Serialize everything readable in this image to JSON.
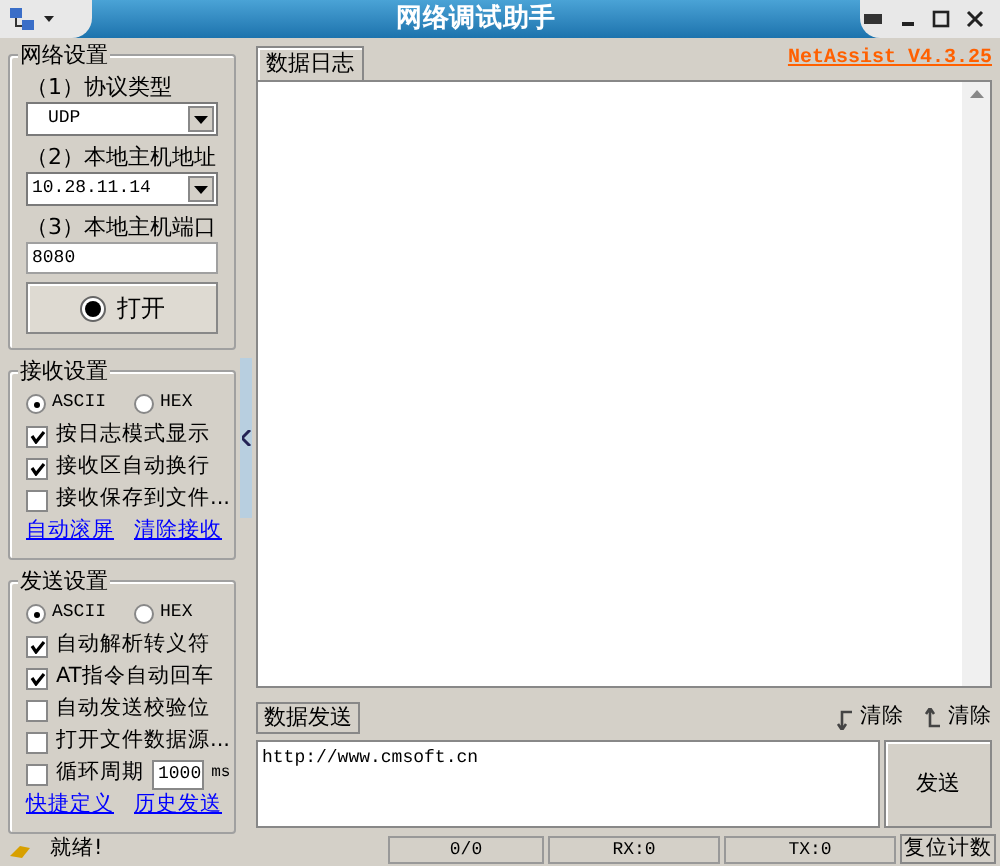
{
  "window": {
    "title": "网络调试助手"
  },
  "network_settings": {
    "title": "网络设置",
    "protocol_label": "（1）协议类型",
    "protocol": "UDP",
    "host_label": "（2）本地主机地址",
    "host": "10.28.11.14",
    "port_label": "（3）本地主机端口",
    "port": "8080",
    "open_button": "打开"
  },
  "receive_settings": {
    "title": "接收设置",
    "encodings": [
      {
        "label": "ASCII",
        "selected": true
      },
      {
        "label": "HEX",
        "selected": false
      }
    ],
    "options": [
      {
        "label": "按日志模式显示",
        "checked": true
      },
      {
        "label": "接收区自动换行",
        "checked": true
      },
      {
        "label": "接收保存到文件...",
        "checked": false
      }
    ],
    "links": [
      "自动滚屏",
      "清除接收"
    ]
  },
  "send_settings": {
    "title": "发送设置",
    "encodings": [
      {
        "label": "ASCII",
        "selected": true
      },
      {
        "label": "HEX",
        "selected": false
      }
    ],
    "options": [
      {
        "label": "自动解析转义符",
        "checked": true
      },
      {
        "label": "AT指令自动回车",
        "checked": true
      },
      {
        "label": "自动发送校验位",
        "checked": false
      },
      {
        "label": "打开文件数据源...",
        "checked": false
      }
    ],
    "loop": {
      "label": "循环周期",
      "checked": false,
      "value": "1000",
      "unit": "ms"
    },
    "links": [
      "快捷定义",
      "历史发送"
    ]
  },
  "log": {
    "tab": "数据日志",
    "version_link": "NetAssist V4.3.25"
  },
  "send": {
    "tab": "数据发送",
    "clear_buttons": [
      "清除",
      "清除"
    ],
    "text": "http://www.cmsoft.cn",
    "send_button": "发送"
  },
  "status_bar": {
    "message": "就绪!",
    "count": "0/0",
    "rx": "RX:0",
    "tx": "TX:0",
    "reset_button": "复位计数"
  }
}
